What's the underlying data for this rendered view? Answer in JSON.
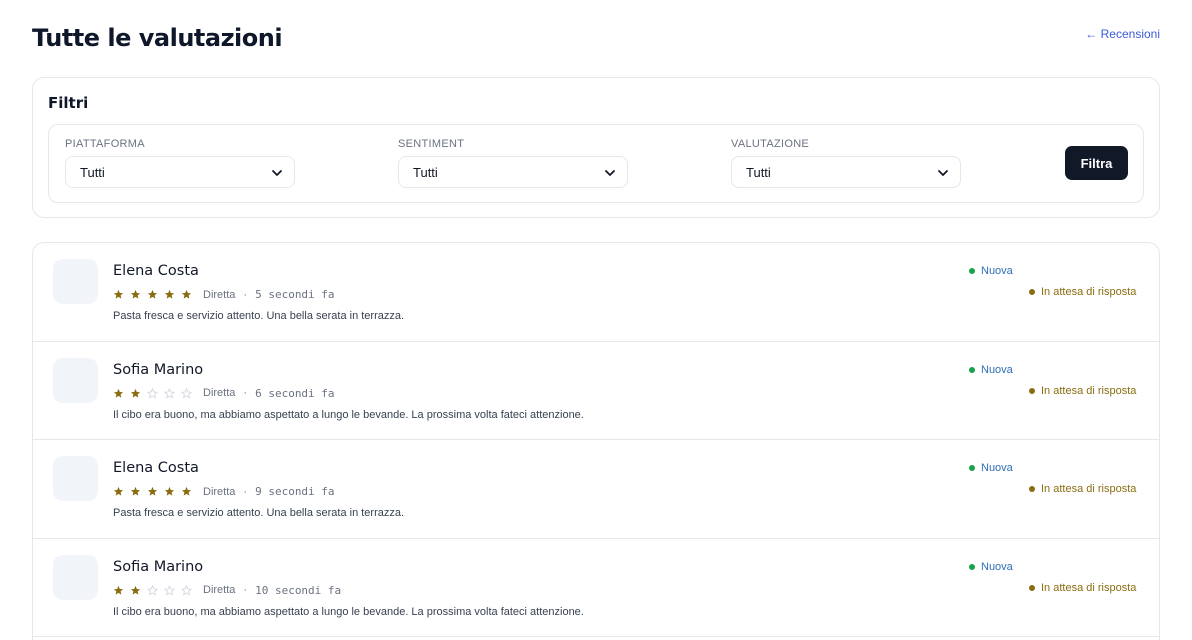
{
  "page": {
    "title": "Tutte le valutazioni",
    "back_link": "← Recensioni"
  },
  "filters": {
    "title": "Filtri",
    "platform": {
      "label": "PIATTAFORMA",
      "value": "Tutti"
    },
    "sentiment": {
      "label": "SENTIMENT",
      "value": "Tutti"
    },
    "rating": {
      "label": "VALUTAZIONE",
      "value": "Tutti"
    },
    "submit_label": "Filtra"
  },
  "colors": {
    "star_filled": "#8a6d10",
    "star_empty": "#cfd4dc",
    "new_dot": "#16a34a",
    "new_text": "#2f6db5",
    "waiting": "#8a6d10",
    "button_bg": "#111827"
  },
  "reviews": [
    {
      "name": "Elena Costa",
      "rating": 5,
      "platform": "Diretta",
      "separator": "·",
      "time": "5 secondi fa",
      "text": "Pasta fresca e servizio attento. Una bella serata in terrazza.",
      "status_new": "Nuova",
      "status_reply": "In attesa di risposta"
    },
    {
      "name": "Sofia Marino",
      "rating": 2,
      "platform": "Diretta",
      "separator": "·",
      "time": "6 secondi fa",
      "text": "Il cibo era buono, ma abbiamo aspettato a lungo le bevande. La prossima volta fateci attenzione.",
      "status_new": "Nuova",
      "status_reply": "In attesa di risposta"
    },
    {
      "name": "Elena Costa",
      "rating": 5,
      "platform": "Diretta",
      "separator": "·",
      "time": "9 secondi fa",
      "text": "Pasta fresca e servizio attento. Una bella serata in terrazza.",
      "status_new": "Nuova",
      "status_reply": "In attesa di risposta"
    },
    {
      "name": "Sofia Marino",
      "rating": 2,
      "platform": "Diretta",
      "separator": "·",
      "time": "10 secondi fa",
      "text": "Il cibo era buono, ma abbiamo aspettato a lungo le bevande. La prossima volta fateci attenzione.",
      "status_new": "Nuova",
      "status_reply": "In attesa di risposta"
    }
  ]
}
